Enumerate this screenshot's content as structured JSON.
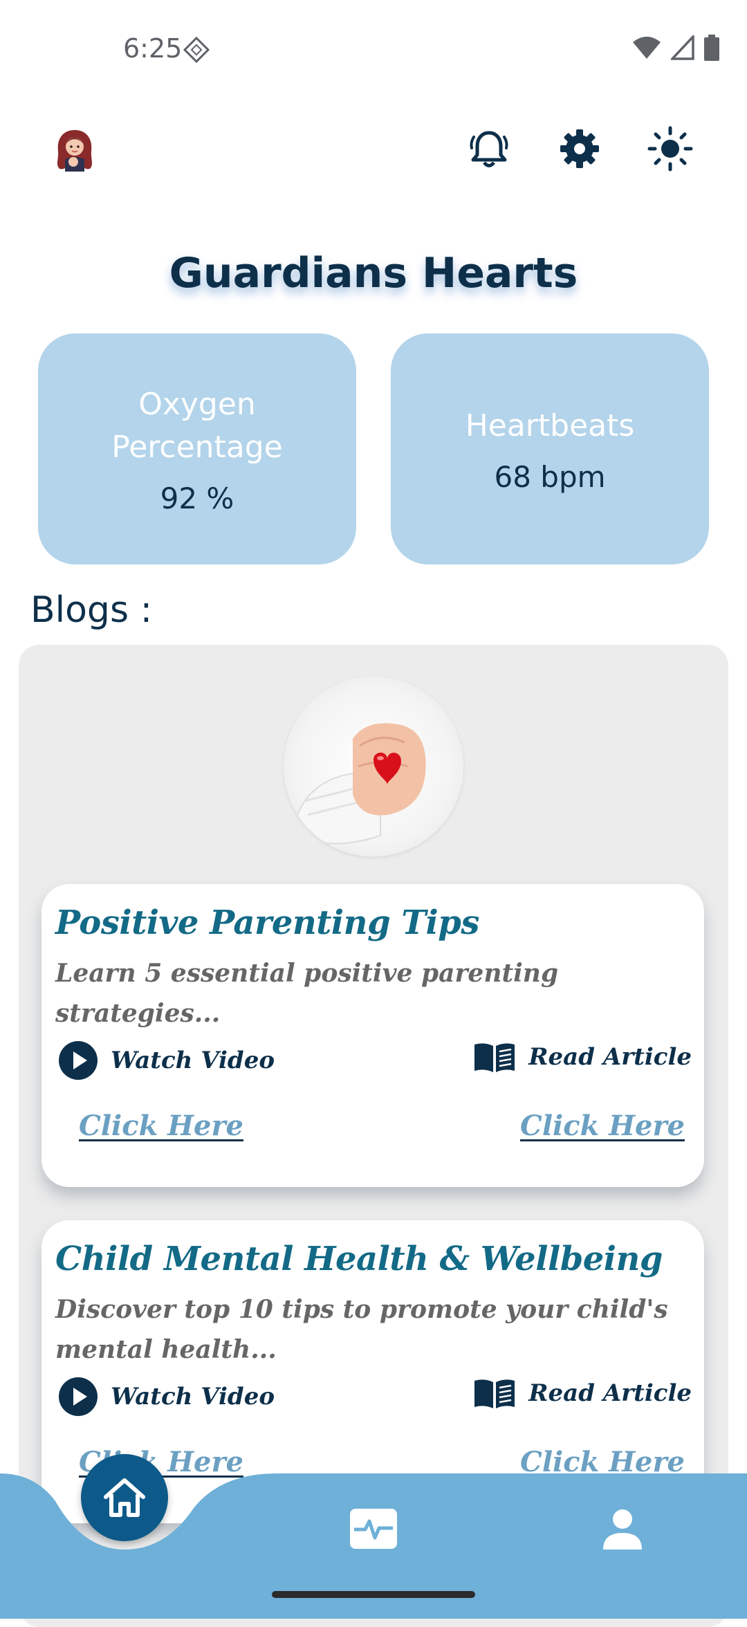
{
  "status_bar": {
    "time": "6:25"
  },
  "header": {
    "avatar": "girl-avatar",
    "icons": [
      "bell-icon",
      "gear-icon",
      "sun-icon"
    ]
  },
  "app": {
    "title": "Guardians Hearts"
  },
  "metrics": [
    {
      "label": "Oxygen Percentage",
      "value": "92 %"
    },
    {
      "label": "Heartbeats",
      "value": "68 bpm"
    }
  ],
  "blogs": {
    "heading": "Blogs :",
    "items": [
      {
        "title": "Positive Parenting Tips",
        "description": "Learn 5 essential positive parenting strategies...",
        "watch_label": "Watch Video",
        "read_label": "Read Article",
        "watch_link": "Click Here",
        "read_link": "Click Here"
      },
      {
        "title": "Child Mental Health & Wellbeing",
        "description": "Discover top 10 tips to promote your child's mental health...",
        "watch_label": "Watch Video",
        "read_label": "Read Article",
        "watch_link": "Click Here",
        "read_link": "Click Here"
      }
    ]
  },
  "bottom_nav": {
    "items": [
      "home-icon",
      "heart-rate-icon",
      "person-icon"
    ],
    "active": "home-icon"
  },
  "colors": {
    "primary_dark": "#0d2f4a",
    "card_blue": "#b3d4ea",
    "nav_blue": "#6eb0d8",
    "title_teal": "#136a86",
    "link_blue": "#6ba0c2"
  }
}
